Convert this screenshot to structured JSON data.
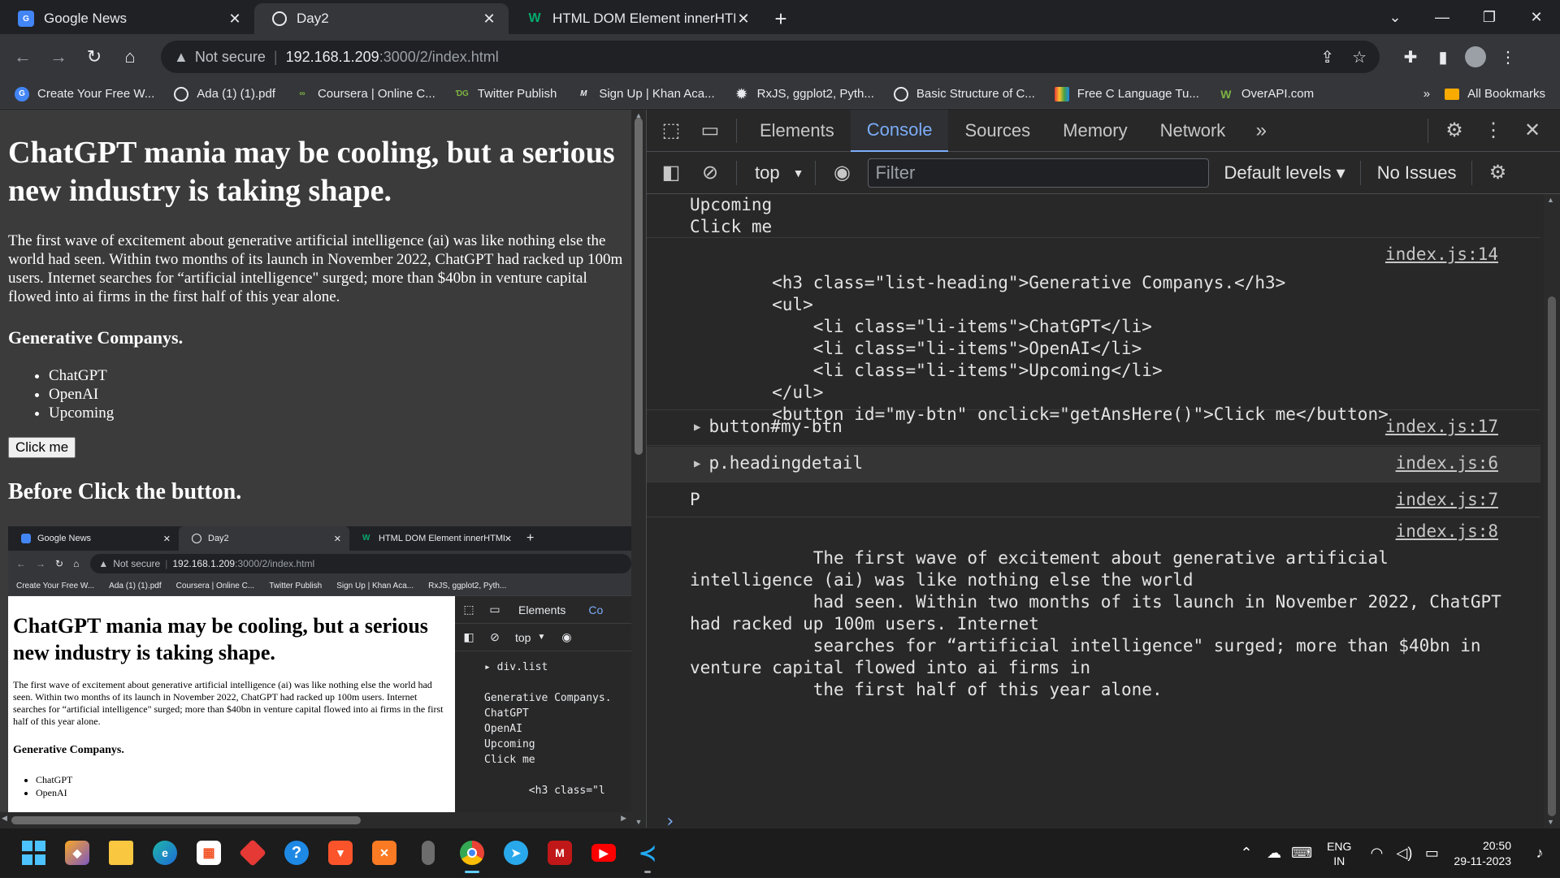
{
  "browser": {
    "tabs": [
      {
        "title": "Google News",
        "favicon": "google-news-icon"
      },
      {
        "title": "Day2",
        "favicon": "globe-icon"
      },
      {
        "title": "HTML DOM Element innerHTML",
        "favicon": "w3schools-icon"
      }
    ],
    "address": {
      "security": "Not secure",
      "host": "192.168.1.209",
      "path": ":3000/2/index.html"
    },
    "bookmarks": [
      "Create Your Free W...",
      "Ada (1) (1).pdf",
      "Coursera | Online C...",
      "Twitter Publish",
      "Sign Up | Khan Aca...",
      "RxJS, ggplot2, Pyth...",
      "Basic Structure of C...",
      "Free C Language Tu...",
      "OverAPI.com"
    ],
    "bookmarks_more": "»",
    "all_bookmarks": "All Bookmarks"
  },
  "page": {
    "title": "ChatGPT mania may be cooling, but a serious new industry is taking shape.",
    "lead": "The first wave of excitement about generative artificial intelligence (ai) was like nothing else the world had seen. Within two months of its launch in November 2022, ChatGPT had racked up 100m users. Internet searches for “artificial intelligence\" surged; more than $40bn in venture capital flowed into ai firms in the first half of this year alone.",
    "list_heading": "Generative Companys.",
    "items": [
      "ChatGPT",
      "OpenAI",
      "Upcoming"
    ],
    "button": "Click me",
    "before_heading": "Before Click the button."
  },
  "embedded": {
    "tabs": [
      "Google News",
      "Day2",
      "HTML DOM Element innerHTML"
    ],
    "security": "Not secure",
    "url_host": "192.168.1.209",
    "url_path": ":3000/2/index.html",
    "bookmarks": [
      "Create Your Free W...",
      "Ada (1) (1).pdf",
      "Coursera | Online C...",
      "Twitter Publish",
      "Sign Up | Khan Aca...",
      "RxJS, ggplot2, Pyth..."
    ],
    "title": "ChatGPT mania may be cooling, but a serious new industry is taking shape.",
    "lead": "The first wave of excitement about generative artificial intelligence (ai) was like nothing else the world had seen. Within two months of its launch in November 2022, ChatGPT had racked up 100m users. Internet searches for “artificial intelligence\" surged; more than $40bn in venture capital flowed into ai firms in the first half of this year alone.",
    "list_heading": "Generative Companys.",
    "items": [
      "ChatGPT",
      "OpenAI"
    ],
    "devtools_tab": "Elements",
    "devtools_tab_partial": "Co",
    "context": "top",
    "console_text": "▸ div.list\n\nGenerative Companys.\nChatGPT\nOpenAI\nUpcoming\nClick me\n\n       <h3 class=\"l"
  },
  "devtools": {
    "tabs": [
      "Elements",
      "Console",
      "Sources",
      "Memory",
      "Network"
    ],
    "active_tab": "Console",
    "more_tabs": "»",
    "context": "top",
    "filter_placeholder": "Filter",
    "levels": "Default levels ▾",
    "issues": "No Issues",
    "messages": [
      {
        "text": "Upcoming\nClick me",
        "source": ""
      },
      {
        "text": "        <h3 class=\"list-heading\">Generative Companys.</h3>\n        <ul>\n            <li class=\"li-items\">ChatGPT</li>\n            <li class=\"li-items\">OpenAI</li>\n            <li class=\"li-items\">Upcoming</li>\n        </ul>\n        <button id=\"my-btn\" onclick=\"getAnsHere()\">Click me</button>",
        "source": "index.js:14"
      },
      {
        "text": "button#my-btn",
        "source": "index.js:17"
      },
      {
        "text": "p.headingdetail",
        "source": "index.js:6"
      },
      {
        "text": "P",
        "source": "index.js:7"
      },
      {
        "text": "            The first wave of excitement about generative artificial\nintelligence (ai) was like nothing else the world\n            had seen. Within two months of its launch in November 2022, ChatGPT\nhad racked up 100m users. Internet\n            searches for “artificial intelligence\" surged; more than $40bn in\nventure capital flowed into ai firms in\n            the first half of this year alone.",
        "source": "index.js:8"
      }
    ],
    "prompt": "›"
  },
  "taskbar": {
    "language": "ENG",
    "region": "IN",
    "time": "20:50",
    "date": "29-11-2023"
  },
  "colors": {
    "accent": "#7cacf8",
    "page_bg": "#3b3b3b",
    "devtools_bg": "#282828"
  }
}
